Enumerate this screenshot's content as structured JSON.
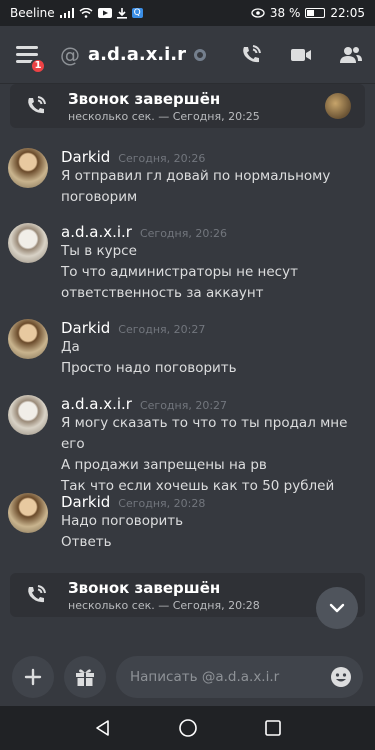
{
  "status_bar": {
    "carrier": "Beeline",
    "signal_icon": "signal-icon",
    "wifi_icon": "wifi-icon",
    "battery_percent": "38 %",
    "time": "22:05"
  },
  "header": {
    "at_symbol": "@",
    "channel_name": "a.d.a.x.i.r",
    "notification_count": "1"
  },
  "calls": [
    {
      "title": "Звонок завершён",
      "subtitle": "несколько сек. — Сегодня, 20:25"
    },
    {
      "title": "Звонок завершён",
      "subtitle": "несколько сек. — Сегодня, 20:28"
    }
  ],
  "messages": [
    {
      "author": "Darkid",
      "time": "Сегодня, 20:26",
      "lines": [
        "Я отправил гл довай по нормальному",
        "поговорим"
      ]
    },
    {
      "author": "a.d.a.x.i.r",
      "time": "Сегодня, 20:26",
      "lines": [
        "Ты в курсе",
        "То что администраторы не несут",
        "ответственность за аккаунт"
      ]
    },
    {
      "author": "Darkid",
      "time": "Сегодня, 20:27",
      "lines": [
        "Да",
        "Просто надо поговорить"
      ]
    },
    {
      "author": "a.d.a.x.i.r",
      "time": "Сегодня, 20:27",
      "lines": [
        "Я могу сказать то что то ты продал мне его",
        "А продажи запрещены на рв",
        "Так что если хочешь как то 50 рублей"
      ]
    },
    {
      "author": "Darkid",
      "time": "Сегодня, 20:28",
      "lines": [
        "Надо поговорить",
        "Ответь"
      ]
    }
  ],
  "composer": {
    "placeholder": "Написать @a.d.a.x.i.r"
  },
  "colors": {
    "background": "#36393f",
    "card": "#2f3136",
    "accent_red": "#ed4245"
  }
}
